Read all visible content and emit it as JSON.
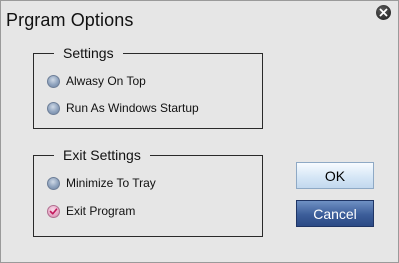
{
  "window": {
    "title": "Prgram Options"
  },
  "settings": {
    "legend": "Settings",
    "options": [
      {
        "label": "Alwasy On Top",
        "checked": false
      },
      {
        "label": "Run As Windows Startup",
        "checked": false
      }
    ]
  },
  "exit_settings": {
    "legend": "Exit Settings",
    "options": [
      {
        "label": "Minimize To Tray",
        "checked": false
      },
      {
        "label": "Exit Program",
        "checked": true
      }
    ]
  },
  "buttons": {
    "ok": "OK",
    "cancel": "Cancel"
  },
  "icons": {
    "close": "close-icon",
    "radio_checked": "checkmark-icon"
  },
  "colors": {
    "accent_checked": "#e7a8c6",
    "cancel_bg": "#3c5d99"
  }
}
